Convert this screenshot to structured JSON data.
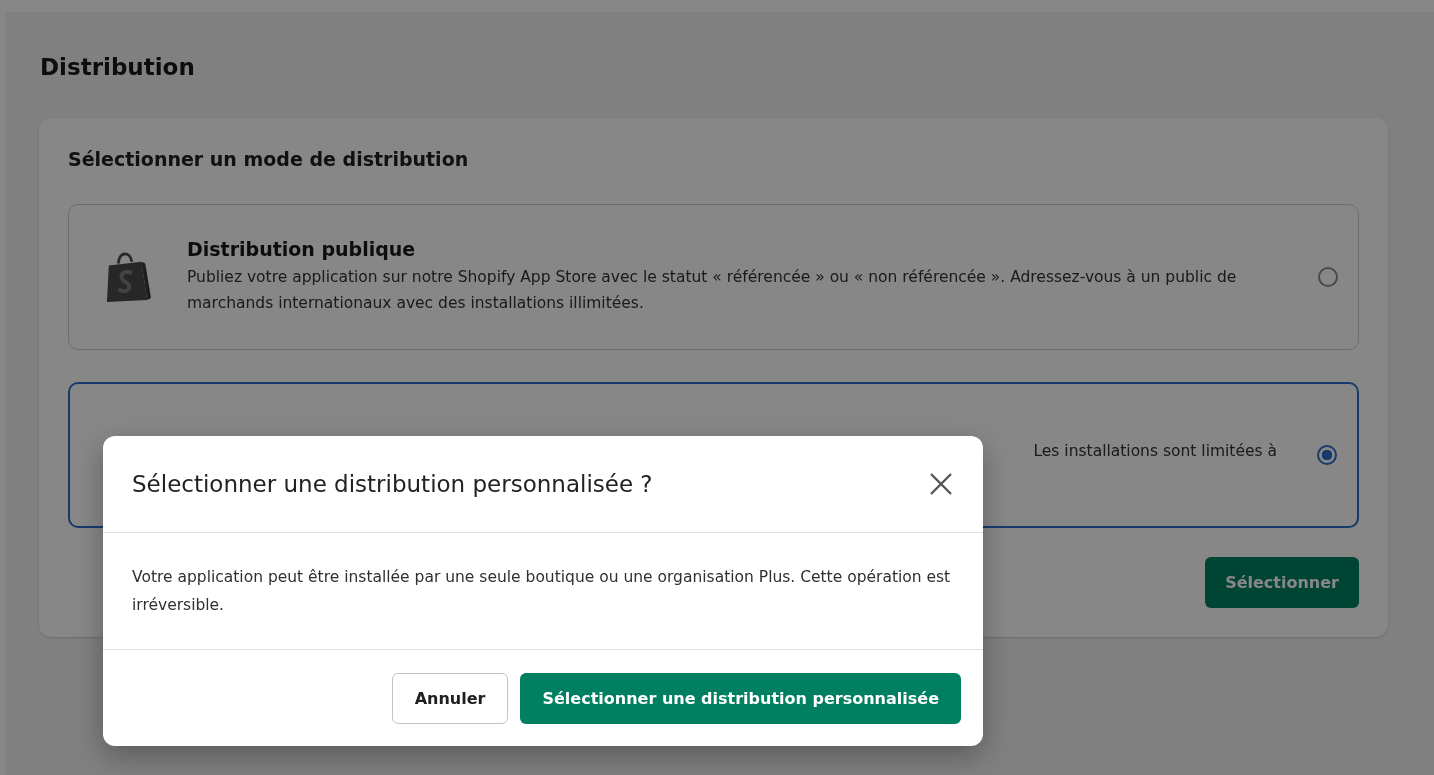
{
  "page": {
    "title": "Distribution"
  },
  "card": {
    "title": "Sélectionner un mode de distribution",
    "options": [
      {
        "kind": "store",
        "title": "Distribution publique",
        "description": "Publiez votre application sur notre Shopify App Store avec le statut « référencée » ou « non référencée ». Adressez-vous à un public de marchands internationaux avec des installations illimitées.",
        "selected": false
      },
      {
        "kind": "hidden",
        "description": "Les installations sont limitées à",
        "selected": true
      }
    ],
    "button": "Sélectionner"
  },
  "dialog": {
    "title": "Sélectionner une distribution personnalisée ?",
    "body": "Votre application peut être installée par une seule boutique ou une organisation Plus. Cette opération est irréversible.",
    "buttons": [
      {
        "kind": "secondary",
        "label": "Annuler"
      },
      {
        "kind": "primary",
        "label": "Sélectionner une distribution personnalisée"
      }
    ]
  }
}
